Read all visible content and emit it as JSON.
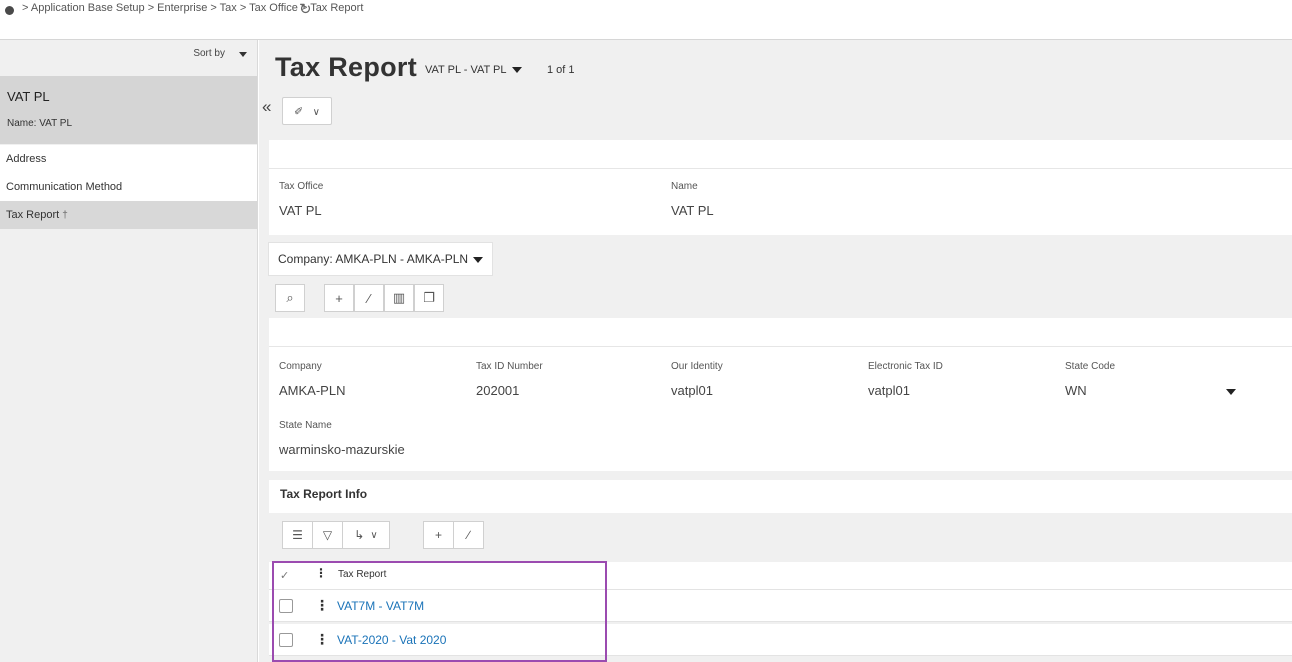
{
  "breadcrumb": {
    "items": [
      "Application Base Setup",
      "Enterprise",
      "Tax",
      "Tax Office",
      "Tax Report"
    ],
    "separator": ">"
  },
  "left_pane": {
    "sort_label": "Sort by",
    "record": {
      "title": "VAT PL",
      "subtitle_label": "Name:",
      "subtitle_value": "VAT PL"
    },
    "nav_items": [
      {
        "label": "Address"
      },
      {
        "label": "Communication Method"
      },
      {
        "label": "Tax Report",
        "active": true,
        "icon": "pin-icon"
      }
    ]
  },
  "page": {
    "title": "Tax Report",
    "selector": "VAT PL - VAT PL",
    "count": "1 of 1"
  },
  "header_fields": {
    "tax_office": {
      "label": "Tax Office",
      "value": "VAT PL"
    },
    "name": {
      "label": "Name",
      "value": "VAT PL"
    }
  },
  "company_selector": {
    "label": "Company: AMKA-PLN - AMKA-PLN"
  },
  "company_fields": {
    "company": {
      "label": "Company",
      "value": "AMKA-PLN"
    },
    "tax_id_number": {
      "label": "Tax ID Number",
      "value": "202001"
    },
    "our_identity": {
      "label": "Our Identity",
      "value": "vatpl01"
    },
    "electronic_tax_id": {
      "label": "Electronic Tax ID",
      "value": "vatpl01"
    },
    "state_code": {
      "label": "State Code",
      "value": "WN"
    },
    "state_name": {
      "label": "State Name",
      "value": "warminsko-mazurskie"
    }
  },
  "tax_report_info": {
    "title": "Tax Report Info",
    "column_header": "Tax Report",
    "rows": [
      {
        "label": "VAT7M - VAT7M"
      },
      {
        "label": "VAT-2020 - Vat 2020"
      }
    ]
  },
  "colors": {
    "highlight": "#9b4bb0",
    "link": "#1a73b8",
    "background": "#f0f0f0"
  }
}
